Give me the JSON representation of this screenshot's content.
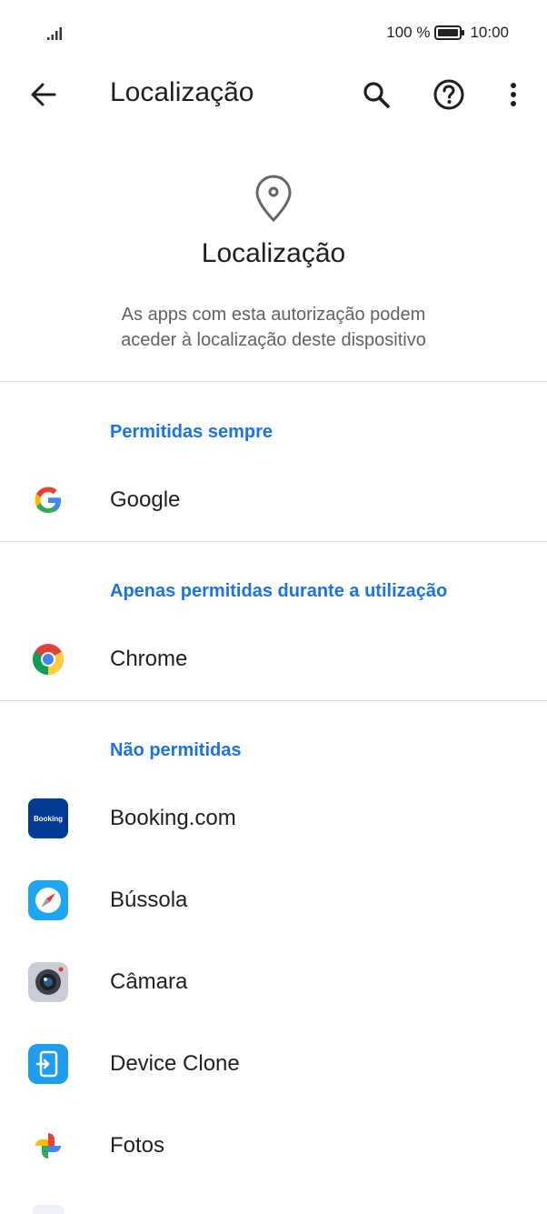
{
  "status_bar": {
    "battery_percent": "100 %",
    "time": "10:00",
    "icons": [
      "signal-icon",
      "battery-icon"
    ]
  },
  "toolbar": {
    "title": "Localização",
    "icons": [
      "back-arrow-icon",
      "search-icon",
      "help-icon",
      "more-vert-icon"
    ]
  },
  "header": {
    "icon": "location-pin-icon",
    "title": "Localização",
    "description_line1": "As apps com esta autorização podem",
    "description_line2": "aceder à localização deste dispositivo"
  },
  "sections": {
    "always": {
      "title": "Permitidas sempre",
      "apps": [
        {
          "label": "Google",
          "icon": "google-icon"
        }
      ]
    },
    "while_using": {
      "title": "Apenas permitidas durante a utilização",
      "apps": [
        {
          "label": "Chrome",
          "icon": "chrome-icon"
        }
      ]
    },
    "denied": {
      "title": "Não permitidas",
      "apps": [
        {
          "label": "Booking.com",
          "icon": "booking-icon",
          "icon_text": "Booking"
        },
        {
          "label": "Bússola",
          "icon": "compass-icon"
        },
        {
          "label": "Câmara",
          "icon": "camera-icon"
        },
        {
          "label": "Device Clone",
          "icon": "device-clone-icon"
        },
        {
          "label": "Fotos",
          "icon": "photos-icon"
        }
      ]
    }
  },
  "colors": {
    "accent": "#1a73e8",
    "text_primary": "#1f1f1f",
    "text_secondary": "#5f6368",
    "divider": "#dcdcdc"
  }
}
